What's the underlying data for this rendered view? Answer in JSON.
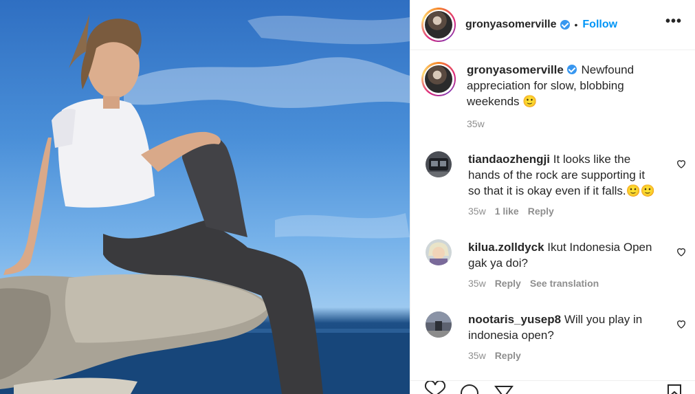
{
  "post": {
    "username": "gronyasomerville",
    "follow_label": "Follow",
    "separator": "•",
    "more_label": "•••"
  },
  "caption": {
    "username": "gronyasomerville",
    "text": " Newfound appreciation for slow, blobbing weekends 🙂",
    "time": "35w"
  },
  "comments": [
    {
      "username": "tiandaozhengji",
      "text": " It looks like the hands of the rock are supporting it so that it is okay even if it falls.🙂🙂",
      "time": "35w",
      "likes": "1 like",
      "reply": "Reply",
      "translate": ""
    },
    {
      "username": "kilua.zolldyck",
      "text": " Ikut Indonesia Open gak ya doi?",
      "time": "35w",
      "likes": "",
      "reply": "Reply",
      "translate": "See translation"
    },
    {
      "username": "nootaris_yusep8",
      "text": " Will you play in indonesia open?",
      "time": "35w",
      "likes": "",
      "reply": "Reply",
      "translate": ""
    }
  ],
  "icons": [
    "verified-badge-icon",
    "more-options-icon",
    "heart-icon",
    "comment-icon",
    "share-icon",
    "bookmark-icon"
  ],
  "colors": {
    "accent": "#0095f6",
    "muted": "#8e8e8e",
    "text": "#262626",
    "verified": "#3897f0"
  }
}
